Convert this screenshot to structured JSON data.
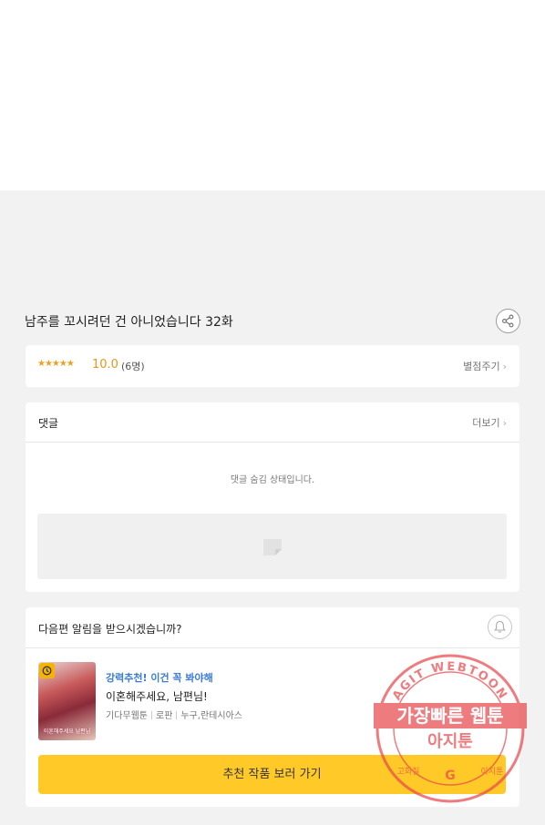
{
  "episode": {
    "title": "남주를 꼬시려던 건 아니었습니다 32화"
  },
  "icons": {
    "share": "share-icon",
    "bell": "bell-icon",
    "clock": "clock-icon",
    "chevron": "chevron-right-icon",
    "comment_placeholder": "comment-placeholder-icon"
  },
  "rating": {
    "stars": "★★★★★",
    "score": "10.0",
    "count": "(6명)",
    "rate_label": "별점주기"
  },
  "comments": {
    "title": "댓글",
    "more_label": "더보기",
    "hidden_message": "댓글 숨김 상태입니다."
  },
  "notify": {
    "prompt": "다음편 알림을 받으시겠습니까?"
  },
  "recommendation": {
    "tag": "강력추천! 이건 꼭 봐야해",
    "title": "이혼해주세요, 남편님!",
    "meta": [
      "기다무웹툰",
      "로판",
      "누구,란테시아스"
    ],
    "button_label": "추천 작품 보러 가기",
    "thumb_caption": "이혼해주세요 남편님"
  },
  "watermark": {
    "arc_text": "AGIT WEBTOON",
    "line1": "가장빠른 웹툰",
    "line2": "아지툰",
    "bottom_left": "고화질",
    "bottom_right": "아지툰",
    "bottom_mark": "G"
  },
  "colors": {
    "accent_yellow": "#ffc928",
    "star_orange": "#e8961a",
    "tag_blue": "#3a7bd5",
    "stamp_red": "#e8454a"
  }
}
